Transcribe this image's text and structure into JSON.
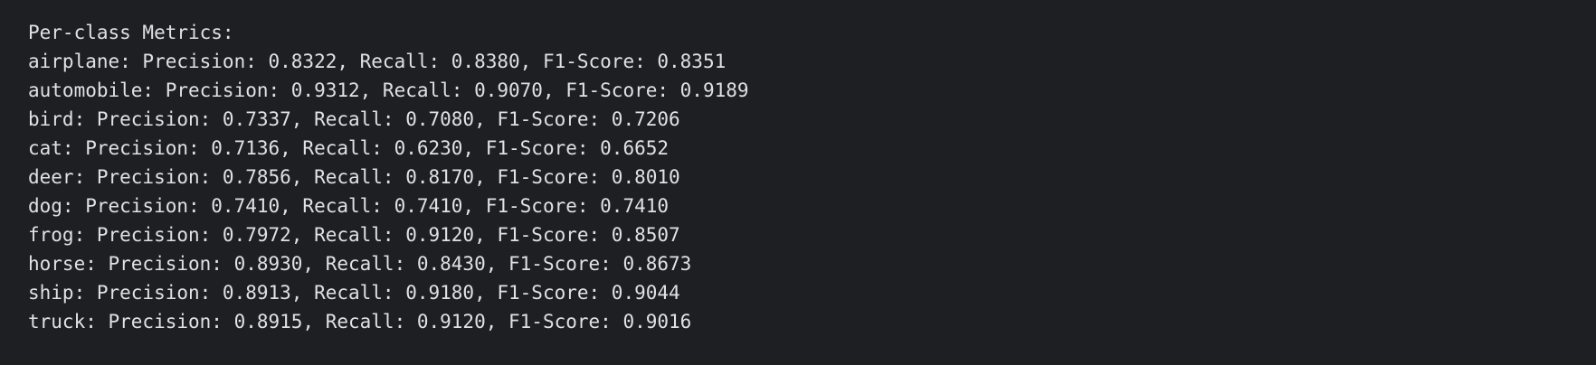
{
  "console": {
    "header": "Per-class Metrics:",
    "lines": [
      "airplane: Precision: 0.8322, Recall: 0.8380, F1-Score: 0.8351",
      "automobile: Precision: 0.9312, Recall: 0.9070, F1-Score: 0.9189",
      "bird: Precision: 0.7337, Recall: 0.7080, F1-Score: 0.7206",
      "cat: Precision: 0.7136, Recall: 0.6230, F1-Score: 0.6652",
      "deer: Precision: 0.7856, Recall: 0.8170, F1-Score: 0.8010",
      "dog: Precision: 0.7410, Recall: 0.7410, F1-Score: 0.7410",
      "frog: Precision: 0.7972, Recall: 0.9120, F1-Score: 0.8507",
      "horse: Precision: 0.8930, Recall: 0.8430, F1-Score: 0.8673",
      "ship: Precision: 0.8913, Recall: 0.9180, F1-Score: 0.9044",
      "truck: Precision: 0.8915, Recall: 0.9120, F1-Score: 0.9016"
    ]
  },
  "colors": {
    "background": "#1e1f22",
    "text": "#dfe1e5"
  }
}
